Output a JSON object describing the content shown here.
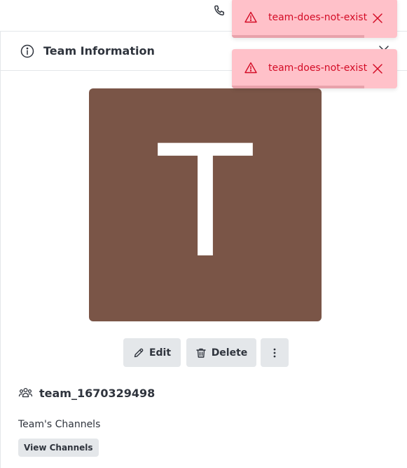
{
  "panel": {
    "title": "Team Information"
  },
  "avatar": {
    "letter": "T",
    "color": "#7a5547"
  },
  "actions": {
    "edit_label": "Edit",
    "delete_label": "Delete"
  },
  "team": {
    "name": "team_1670329498"
  },
  "channels": {
    "label": "Team's Channels",
    "view_button_label": "View Channels"
  },
  "toasts": [
    {
      "message": "team-does-not-exist",
      "progress": 0.8
    },
    {
      "message": "team-does-not-exist",
      "progress": 0.8
    }
  ],
  "colors": {
    "toast_background": "#ffc1c9",
    "toast_text": "#d40c26",
    "button_background": "#e4e7ea",
    "text_primary": "#2f343d"
  },
  "icons": {
    "call": "phone-icon",
    "info": "info-icon",
    "close_panel": "close-icon",
    "edit": "pencil-icon",
    "delete": "trash-icon",
    "more": "kebab-icon",
    "team": "team-icon",
    "toast_warning": "warning-icon",
    "toast_close": "close-icon"
  }
}
